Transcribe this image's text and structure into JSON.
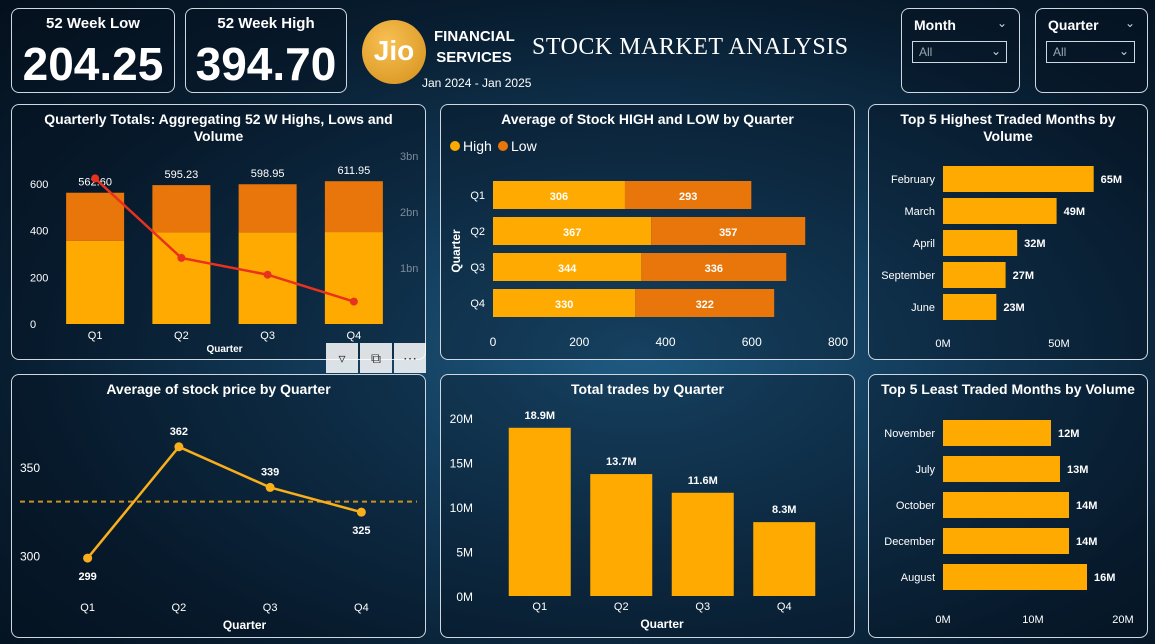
{
  "kpis": {
    "low": {
      "label": "52 Week Low",
      "value": "204.25"
    },
    "high": {
      "label": "52 Week High",
      "value": "394.70"
    }
  },
  "header": {
    "logo_text": "Jio",
    "brand_line1": "FINANCIAL",
    "brand_line2": "SERVICES",
    "period": "Jan 2024 -  Jan 2025",
    "title": "STOCK MARKET ANALYSIS"
  },
  "slicers": {
    "month": {
      "label": "Month",
      "value": "All"
    },
    "quarter": {
      "label": "Quarter",
      "value": "All"
    }
  },
  "colors": {
    "high": "#FFAA00",
    "low": "#E8760A",
    "line_red": "#E8321E",
    "line_gold": "#F9AE1B"
  },
  "charts": {
    "quarterly_totals": {
      "title": "Quarterly Totals: Aggregating 52 W Highs, Lows and Volume"
    },
    "avg_high_low": {
      "title": "Average of Stock HIGH and LOW by Quarter"
    },
    "top5_high": {
      "title": "Top 5 Highest Traded Months by Volume"
    },
    "avg_price": {
      "title": "Average of stock price by Quarter"
    },
    "total_trades": {
      "title": "Total trades by Quarter"
    },
    "top5_low": {
      "title": "Top 5 Least Traded Months by Volume"
    }
  },
  "chart_data": [
    {
      "id": "quarterly_totals",
      "type": "bar",
      "title": "Quarterly Totals: Aggregating 52 W Highs, Lows and Volume",
      "xlabel": "Quarter",
      "categories": [
        "Q1",
        "Q2",
        "Q3",
        "Q4"
      ],
      "series": [
        {
          "name": "High",
          "values": [
            356,
            392,
            393,
            394
          ]
        },
        {
          "name": "Low",
          "values": [
            206.6,
            203.23,
            205.95,
            217.95
          ]
        }
      ],
      "totals": [
        "562.60",
        "595.23",
        "598.95",
        "611.95"
      ],
      "line": {
        "name": "Volume",
        "values": [
          2.6,
          1.18,
          0.88,
          0.4
        ]
      },
      "ylim": [
        0,
        600
      ],
      "yticks": [
        "0",
        "200",
        "400",
        "600"
      ],
      "y2lim": [
        0,
        3
      ],
      "y2ticks": [
        "1bn",
        "2bn",
        "3bn"
      ]
    },
    {
      "id": "avg_high_low",
      "type": "bar",
      "orientation": "horizontal",
      "stacked": true,
      "title": "Average of Stock HIGH and LOW by Quarter",
      "ylabel": "Quarter",
      "categories": [
        "Q1",
        "Q2",
        "Q3",
        "Q4"
      ],
      "series": [
        {
          "name": "High",
          "values": [
            306,
            367,
            344,
            330
          ]
        },
        {
          "name": "Low",
          "values": [
            293,
            357,
            336,
            322
          ]
        }
      ],
      "xlim": [
        0,
        800
      ],
      "xticks": [
        "0",
        "200",
        "400",
        "600",
        "800"
      ],
      "legend": "top-left"
    },
    {
      "id": "top5_high",
      "type": "bar",
      "orientation": "horizontal",
      "title": "Top 5 Highest Traded Months by Volume",
      "categories": [
        "February",
        "March",
        "April",
        "September",
        "June"
      ],
      "values": [
        65,
        49,
        32,
        27,
        23
      ],
      "labels": [
        "65M",
        "49M",
        "32M",
        "27M",
        "23M"
      ],
      "xlim": [
        0,
        66
      ],
      "xticks": [
        {
          "v": 0,
          "t": "0M"
        },
        {
          "v": 50,
          "t": "50M"
        }
      ]
    },
    {
      "id": "avg_price",
      "type": "line",
      "title": "Average of stock price by Quarter",
      "xlabel": "Quarter",
      "categories": [
        "Q1",
        "Q2",
        "Q3",
        "Q4"
      ],
      "values": [
        299,
        362,
        339,
        325
      ],
      "average": 331,
      "ylim": [
        290,
        380
      ],
      "yticks": [
        {
          "v": 300,
          "t": "300"
        },
        {
          "v": 350,
          "t": "350"
        }
      ]
    },
    {
      "id": "total_trades",
      "type": "bar",
      "title": "Total trades by Quarter",
      "xlabel": "Quarter",
      "categories": [
        "Q1",
        "Q2",
        "Q3",
        "Q4"
      ],
      "values": [
        18.9,
        13.7,
        11.6,
        8.3
      ],
      "labels": [
        "18.9M",
        "13.7M",
        "11.6M",
        "8.3M"
      ],
      "ylim": [
        0,
        20
      ],
      "yticks": [
        {
          "v": 0,
          "t": "0M"
        },
        {
          "v": 5,
          "t": "5M"
        },
        {
          "v": 10,
          "t": "10M"
        },
        {
          "v": 15,
          "t": "15M"
        },
        {
          "v": 20,
          "t": "20M"
        }
      ]
    },
    {
      "id": "top5_low",
      "type": "bar",
      "orientation": "horizontal",
      "title": "Top 5 Least Traded Months by Volume",
      "categories": [
        "November",
        "July",
        "October",
        "December",
        "August"
      ],
      "values": [
        12,
        13,
        14,
        14,
        16
      ],
      "labels": [
        "12M",
        "13M",
        "14M",
        "14M",
        "16M"
      ],
      "xlim": [
        0,
        20
      ],
      "xticks": [
        {
          "v": 0,
          "t": "0M"
        },
        {
          "v": 10,
          "t": "10M"
        },
        {
          "v": 20,
          "t": "20M"
        }
      ]
    }
  ]
}
